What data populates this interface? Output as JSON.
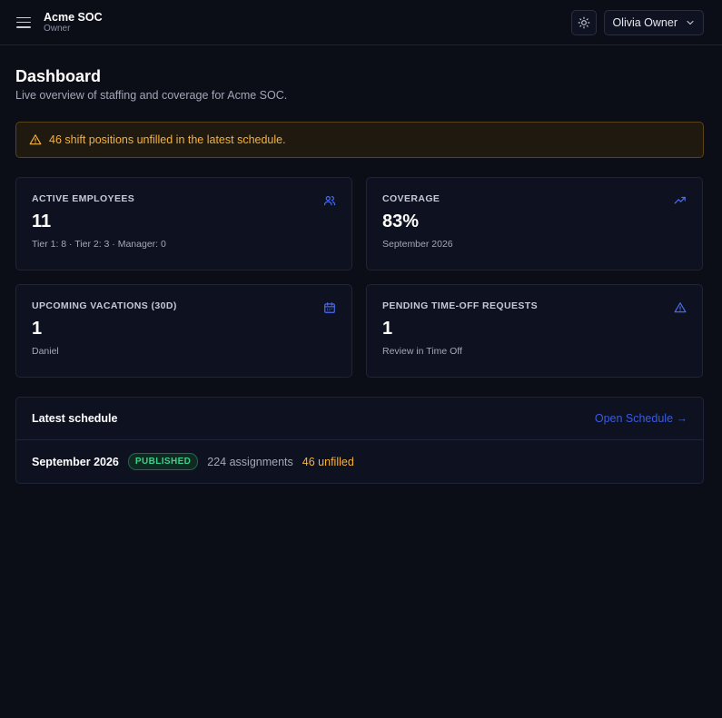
{
  "header": {
    "org_name": "Acme SOC",
    "org_role": "Owner",
    "user_name": "Olivia Owner"
  },
  "page": {
    "title": "Dashboard",
    "subtitle": "Live overview of staffing and coverage for Acme SOC."
  },
  "alert": {
    "text": "46 shift positions unfilled in the latest schedule."
  },
  "cards": [
    {
      "label": "ACTIVE EMPLOYEES",
      "value": "11",
      "note": "Tier 1: 8 · Tier 2: 3 · Manager: 0",
      "icon": "users-icon"
    },
    {
      "label": "COVERAGE",
      "value": "83%",
      "note": "September 2026",
      "icon": "trending-up-icon"
    },
    {
      "label": "UPCOMING VACATIONS (30D)",
      "value": "1",
      "note": "Daniel",
      "icon": "calendar-icon"
    },
    {
      "label": "PENDING TIME-OFF REQUESTS",
      "value": "1",
      "note": "Review in Time Off",
      "icon": "warning-icon"
    }
  ],
  "schedule": {
    "title": "Latest schedule",
    "link_label": "Open Schedule →",
    "month": "September 2026",
    "status": "PUBLISHED",
    "assignments": "224 assignments",
    "unfilled": "46 unfilled"
  },
  "colors": {
    "background": "#0b0d17",
    "accent": "#3b5bdb",
    "warning": "#f5b23b",
    "success": "#3ecf8e"
  }
}
